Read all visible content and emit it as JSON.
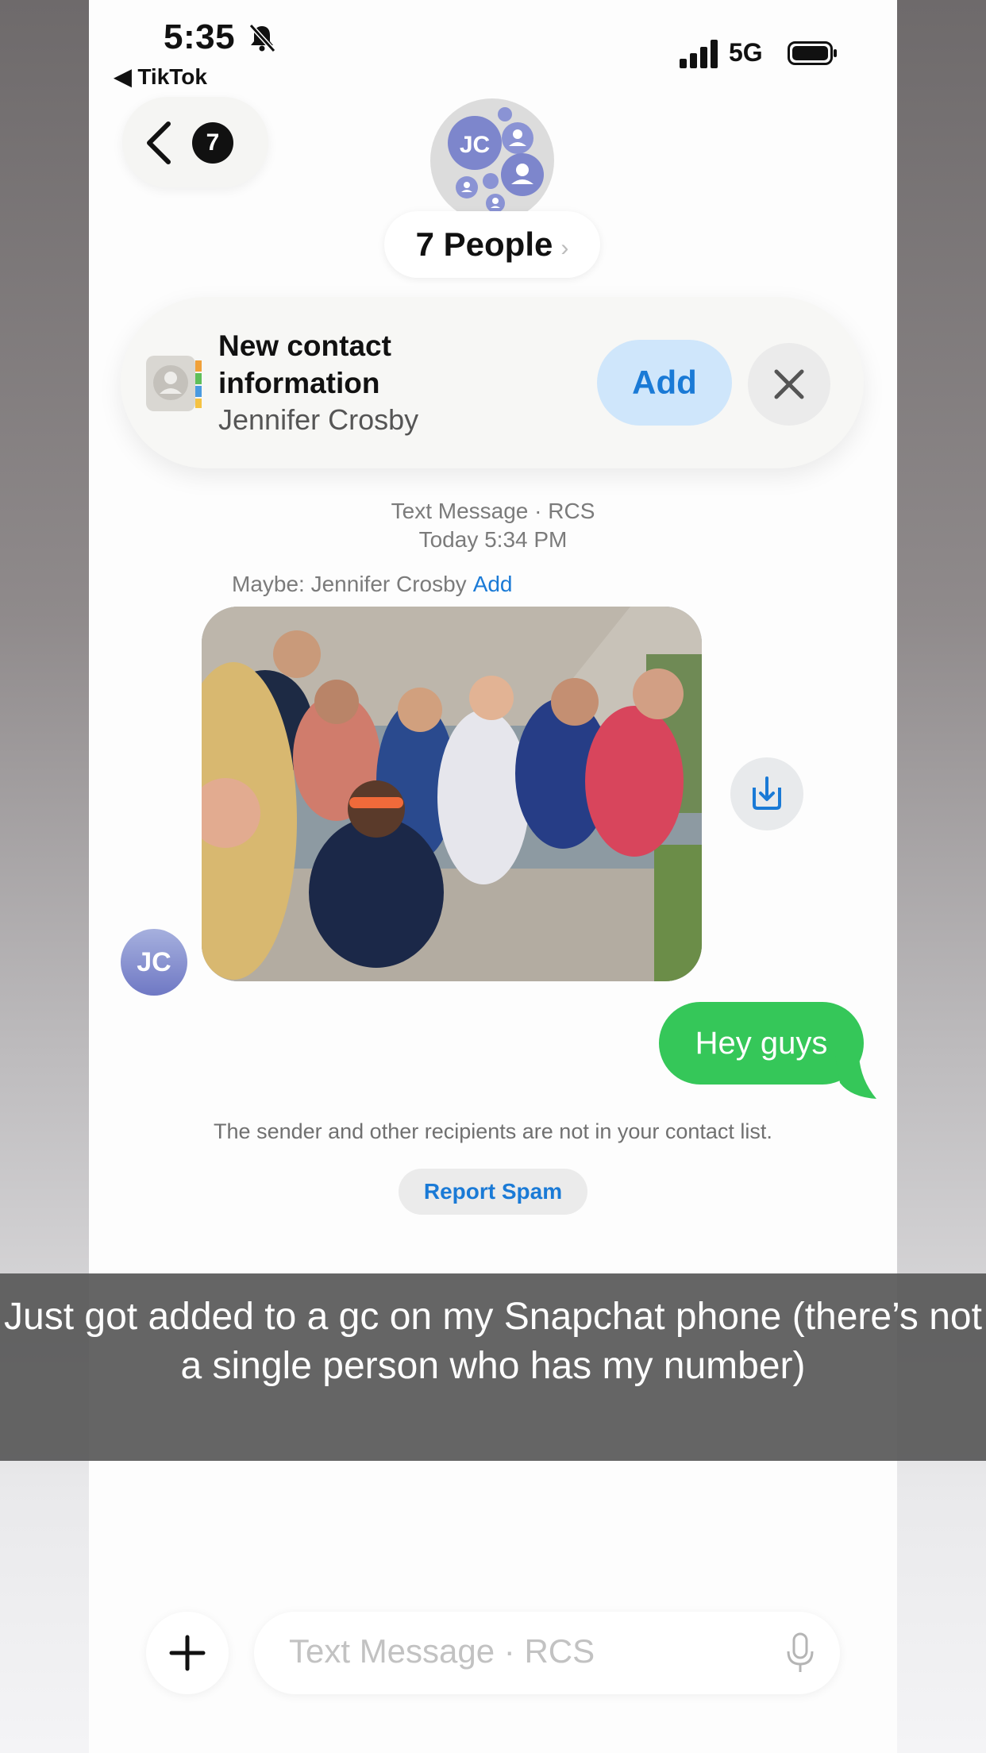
{
  "status_bar": {
    "time": "5:35",
    "back_app": "◀ TikTok",
    "network": "5G"
  },
  "nav": {
    "unread_count": "7",
    "group_initials": "JC",
    "group_title": "7 People",
    "group_chevron": "›"
  },
  "contact_card": {
    "title": "New contact information",
    "name": "Jennifer Crosby",
    "add_label": "Add"
  },
  "conversation": {
    "service_label": "Text Message · RCS",
    "timestamp": "Today 5:34 PM",
    "maybe_label": "Maybe: Jennifer Crosby",
    "maybe_add": "Add",
    "sender_initials": "JC",
    "sent_message": "Hey guys",
    "notice": "The sender and other recipients are not in your contact list.",
    "report_spam": "Report Spam"
  },
  "caption": "Just got added to a gc on my Snapchat phone (there’s not a single person who has my number)",
  "composer": {
    "placeholder": "Text Message · RCS"
  },
  "colors": {
    "accent": "#1a7ad6",
    "sent_bubble": "#35c759"
  },
  "icons": [
    "bell-slash-icon",
    "signal-icon",
    "battery-icon",
    "back-chevron-icon",
    "contacts-app-icon",
    "close-icon",
    "save-photo-icon",
    "plus-icon",
    "microphone-icon"
  ]
}
